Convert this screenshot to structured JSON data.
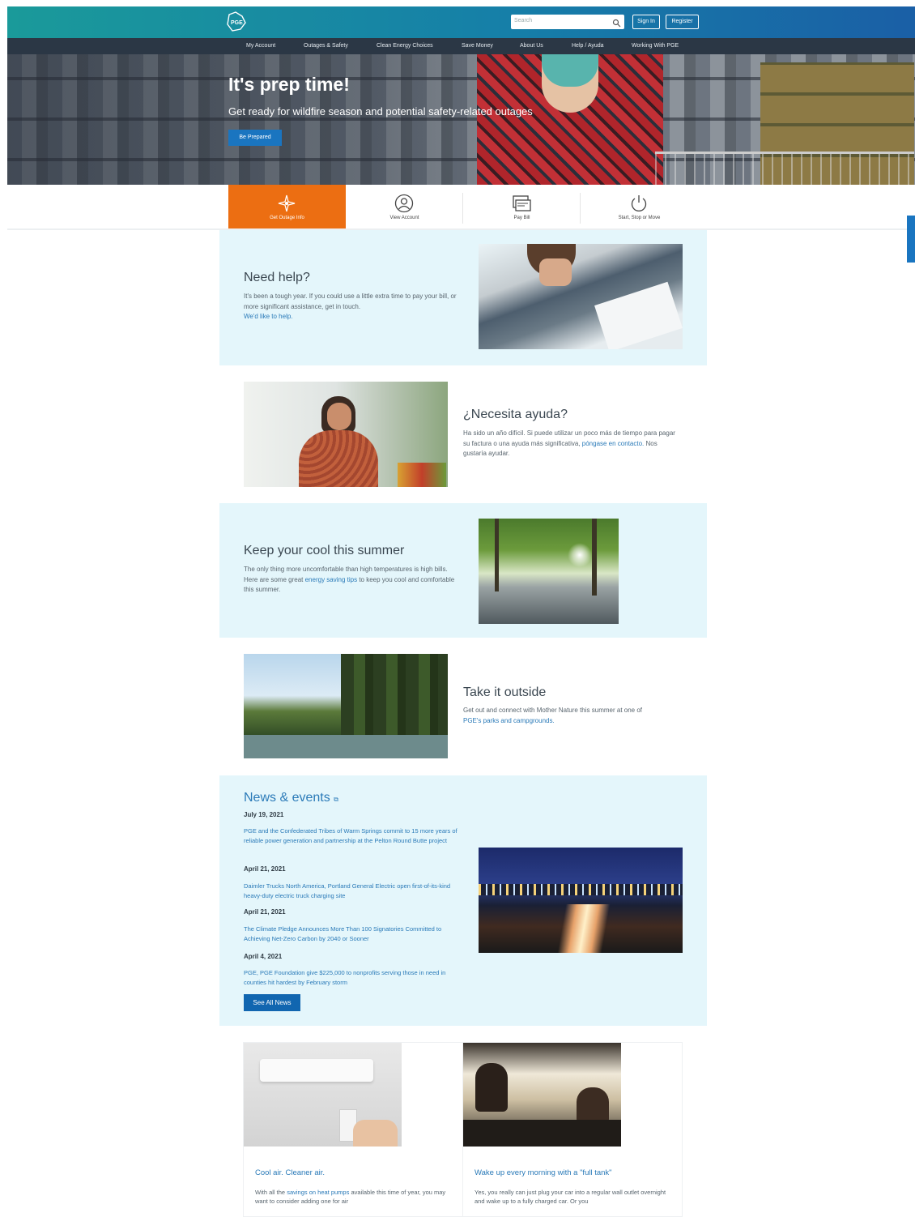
{
  "header": {
    "search_placeholder": "Search",
    "sign_in_label": "Sign In",
    "register_label": "Register"
  },
  "nav": {
    "items": [
      "My Account",
      "Outages & Safety",
      "Clean Energy Choices",
      "Save Money",
      "About Us",
      "Help / Ayuda",
      "Working With PGE"
    ]
  },
  "hero": {
    "title": "It's prep time!",
    "subtitle": "Get ready for wildfire season and potential safety-related outages",
    "button_label": "Be Prepared"
  },
  "quick_links": [
    {
      "label": "Get Outage Info",
      "icon": "outage-icon",
      "active": true
    },
    {
      "label": "View Account",
      "icon": "account-icon",
      "active": false
    },
    {
      "label": "Pay Bill",
      "icon": "bill-icon",
      "active": false
    },
    {
      "label": "Start, Stop or Move",
      "icon": "power-icon",
      "active": false
    }
  ],
  "feedback_label": "Feedback",
  "need_help": {
    "heading": "Need help?",
    "body": "It's been a tough year. If you could use a little extra time to pay your bill, or more significant assistance, get in touch.",
    "link": "We'd like to help."
  },
  "necesita": {
    "heading": "¿Necesita ayuda?",
    "body": "Ha sido un año difícil. Si puede utilizar un poco más de tiempo para pagar su factura o una ayuda más significativa,",
    "link": "póngase en contacto.",
    "tail": "Nos gustaría ayudar."
  },
  "keep_cool": {
    "heading": "Keep your cool this summer",
    "body_pre": "The only thing more uncomfortable than high temperatures is high bills. Here are some great",
    "link": "energy saving tips",
    "body_post": "to keep you cool and comfortable this summer."
  },
  "outside": {
    "heading": "Take it outside",
    "body": "Get out and connect with Mother Nature this summer at one of",
    "link": "PGE's parks and campgrounds."
  },
  "news": {
    "heading": "News & events",
    "items": [
      {
        "date": "July 19, 2021",
        "title": "PGE and the Confederated Tribes of Warm Springs commit to 15 more years of reliable power generation and partnership at the Pelton Round Butte project"
      },
      {
        "date": "April 21, 2021",
        "title": "Daimler Trucks North America, Portland General Electric open first-of-its-kind heavy-duty electric truck charging site"
      },
      {
        "date": "April 21, 2021",
        "title": "The Climate Pledge Announces More Than 100 Signatories Committed to Achieving Net-Zero Carbon by 2040 or Sooner"
      },
      {
        "date": "April 4, 2021",
        "title": "PGE, PGE Foundation give $225,000 to nonprofits serving those in need in counties hit hardest by February storm"
      }
    ],
    "button_label": "See All News"
  },
  "cards": [
    {
      "title": "Cool air. Cleaner air.",
      "body_pre": "With all the",
      "link": "savings on heat pumps",
      "body_post": "available this time of year, you may want to consider adding one for air"
    },
    {
      "title": "Wake up every morning with a \"full tank\"",
      "body_pre": "Yes, you really can just plug your car into a regular wall outlet overnight and wake up to a fully charged car. Or you",
      "link": "",
      "body_post": ""
    }
  ],
  "colors": {
    "accent_orange": "#ec6e12",
    "brand_blue": "#1a75c0",
    "panel_blue": "#e4f6fb",
    "nav_dark": "#2b3745"
  }
}
